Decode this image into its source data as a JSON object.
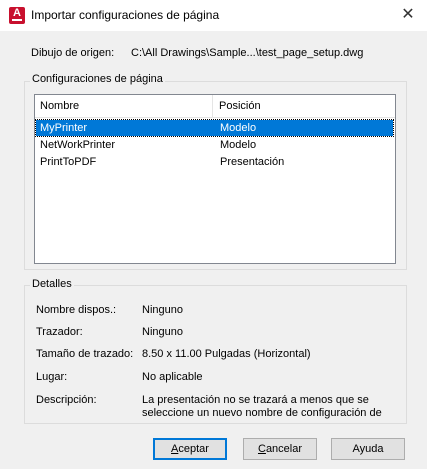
{
  "window": {
    "title": "Importar configuraciones de página",
    "close_glyph": "✕",
    "app_icon_letter": "A"
  },
  "source": {
    "label": "Dibujo de origen:",
    "value": "C:\\All Drawings\\Sample...\\test_page_setup.dwg"
  },
  "page_setups": {
    "group_title": "Configuraciones de página",
    "columns": [
      "Nombre",
      "Posición"
    ],
    "rows": [
      {
        "name": "MyPrinter",
        "position": "Modelo",
        "selected": true
      },
      {
        "name": "NetWorkPrinter",
        "position": "Modelo",
        "selected": false
      },
      {
        "name": "PrintToPDF",
        "position": "Presentación",
        "selected": false
      }
    ]
  },
  "details": {
    "group_title": "Detalles",
    "items": [
      {
        "label": "Nombre dispos.:",
        "value": "Ninguno"
      },
      {
        "label": "Trazador:",
        "value": "Ninguno"
      },
      {
        "label": "Tamaño de trazado:",
        "value": "8.50 x 11.00 Pulgadas (Horizontal)"
      },
      {
        "label": "Lugar:",
        "value": "No aplicable"
      },
      {
        "label": "Descripción:",
        "value_line1": "La presentación no se trazará a menos que se",
        "value_line2": "seleccione un nuevo nombre de configuración de"
      }
    ]
  },
  "buttons": {
    "accept": {
      "mnemonic": "A",
      "rest": "ceptar"
    },
    "cancel": {
      "mnemonic": "C",
      "rest": "ancelar"
    },
    "help": "Ayuda"
  }
}
